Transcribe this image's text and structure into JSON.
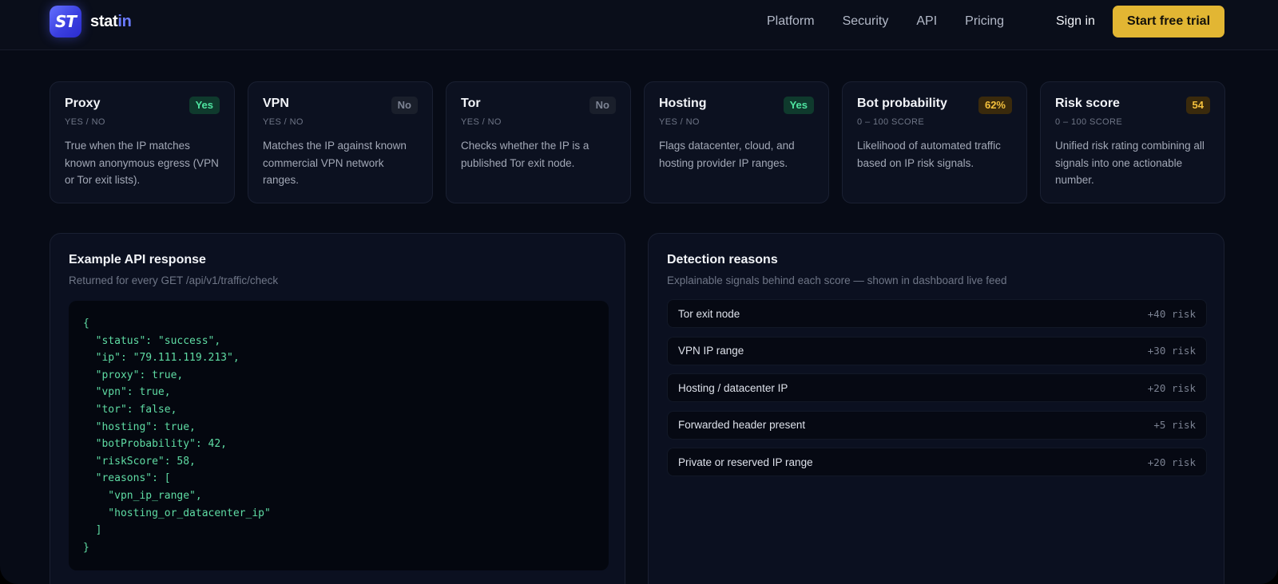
{
  "brand": {
    "logo_text": "ST",
    "name_main": "stat",
    "name_accent": "in"
  },
  "nav": {
    "links": [
      "Platform",
      "Security",
      "API",
      "Pricing"
    ],
    "signin": "Sign in",
    "cta": "Start free trial"
  },
  "cards": [
    {
      "title": "Proxy",
      "badge": "Yes",
      "badge_tone": "green",
      "sub": "YES / NO",
      "desc": "True when the IP matches known anonymous egress (VPN or Tor exit lists)."
    },
    {
      "title": "VPN",
      "badge": "No",
      "badge_tone": "gray",
      "sub": "YES / NO",
      "desc": "Matches the IP against known commercial VPN network ranges."
    },
    {
      "title": "Tor",
      "badge": "No",
      "badge_tone": "gray",
      "sub": "YES / NO",
      "desc": "Checks whether the IP is a published Tor exit node."
    },
    {
      "title": "Hosting",
      "badge": "Yes",
      "badge_tone": "green",
      "sub": "YES / NO",
      "desc": "Flags datacenter, cloud, and hosting provider IP ranges."
    },
    {
      "title": "Bot probability",
      "badge": "62%",
      "badge_tone": "amber",
      "sub": "0 – 100 SCORE",
      "desc": "Likelihood of automated traffic based on IP risk signals."
    },
    {
      "title": "Risk score",
      "badge": "54",
      "badge_tone": "amber",
      "sub": "0 – 100 SCORE",
      "desc": "Unified risk rating combining all signals into one actionable number."
    }
  ],
  "api_panel": {
    "title": "Example API response",
    "subtitle": "Returned for every GET /api/v1/traffic/check",
    "code_lines": [
      "{",
      "  \"status\": \"success\",",
      "  \"ip\": \"79.111.119.213\",",
      "  \"proxy\": true,",
      "  \"vpn\": true,",
      "  \"tor\": false,",
      "  \"hosting\": true,",
      "  \"botProbability\": 42,",
      "  \"riskScore\": 58,",
      "  \"reasons\": [",
      "    \"vpn_ip_range\",",
      "    \"hosting_or_datacenter_ip\"",
      "  ]",
      "}"
    ]
  },
  "reasons_panel": {
    "title": "Detection reasons",
    "subtitle": "Explainable signals behind each score — shown in dashboard live feed",
    "items": [
      {
        "label": "Tor exit node",
        "risk": "+40 risk"
      },
      {
        "label": "VPN IP range",
        "risk": "+30 risk"
      },
      {
        "label": "Hosting / datacenter IP",
        "risk": "+20 risk"
      },
      {
        "label": "Forwarded header present",
        "risk": "+5 risk"
      },
      {
        "label": "Private or reserved IP range",
        "risk": "+20 risk"
      }
    ]
  },
  "colors": {
    "accent": "#6b7bff",
    "cta": "#e2b633",
    "yes": "#4ee4a0",
    "score": "#f4c13d",
    "code": "#5fdca4"
  }
}
